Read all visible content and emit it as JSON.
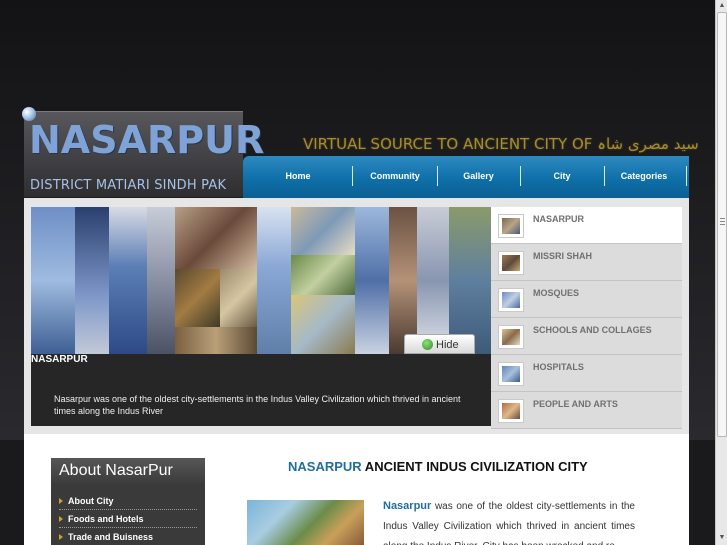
{
  "header": {
    "logo_title": "NASARPUR",
    "logo_subtitle": "DISTRICT MATIARI SINDH PAK",
    "tagline": "VIRTUAL SOURCE TO ANCIENT CITY OF سید مصری شاہ"
  },
  "nav": {
    "items": [
      {
        "label": "Home"
      },
      {
        "label": "Community"
      },
      {
        "label": "Gallery"
      },
      {
        "label": "City"
      },
      {
        "label": "Categories"
      }
    ]
  },
  "slider": {
    "caption_title": "NASARPUR",
    "caption_text": "Nasarpur was one of the oldest city-settlements in the Indus Valley Civilization which thrived in ancient times along the Indus River",
    "hide_label": "Hide"
  },
  "thumbs": [
    {
      "label": "NASARPUR",
      "active": true
    },
    {
      "label": "MISSRI SHAH",
      "active": false
    },
    {
      "label": "MOSQUES",
      "active": false
    },
    {
      "label": "SCHOOLS AND COLLAGES",
      "active": false
    },
    {
      "label": "HOSPITALS",
      "active": false
    },
    {
      "label": "PEOPLE AND ARTS",
      "active": false
    }
  ],
  "sidebar": {
    "heading": "About NasarPur",
    "items": [
      {
        "label": "About City"
      },
      {
        "label": "Foods and Hotels"
      },
      {
        "label": "Trade and Buisness"
      }
    ]
  },
  "main": {
    "heading_accent": "NASARPUR",
    "heading_rest": " ANCIENT INDUS CIVILIZATION CITY",
    "lead_word": "Nasarpur",
    "body": " was one of the oldest city-settlements in the Indus Valley Civilization which thrived in ancient times along the Indus River. City has been wrecked and re-"
  },
  "colors": {
    "nav_blue": "#0f6fa8",
    "accent_blue": "#1f6fa0",
    "logo_blue": "#7fa3d6",
    "tagline_gold": "#a38c35"
  }
}
